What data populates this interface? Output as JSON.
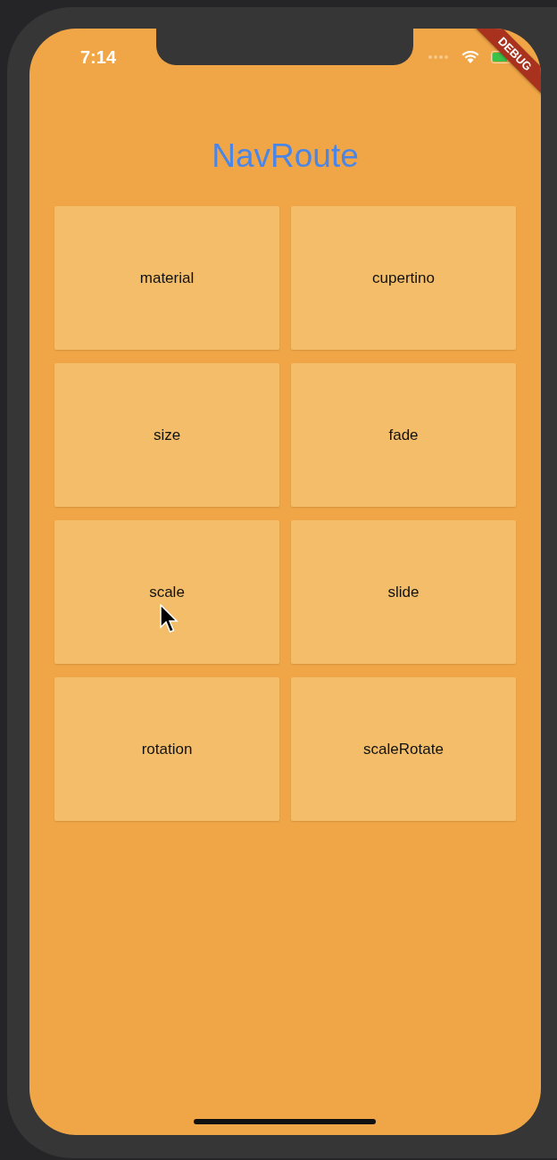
{
  "status_bar": {
    "time": "7:14"
  },
  "debug_banner": "DEBUG",
  "title": "NavRoute",
  "buttons": [
    {
      "label": "material"
    },
    {
      "label": "cupertino"
    },
    {
      "label": "size"
    },
    {
      "label": "fade"
    },
    {
      "label": "scale",
      "pointer": true
    },
    {
      "label": "slide"
    },
    {
      "label": "rotation"
    },
    {
      "label": "scaleRotate"
    }
  ]
}
